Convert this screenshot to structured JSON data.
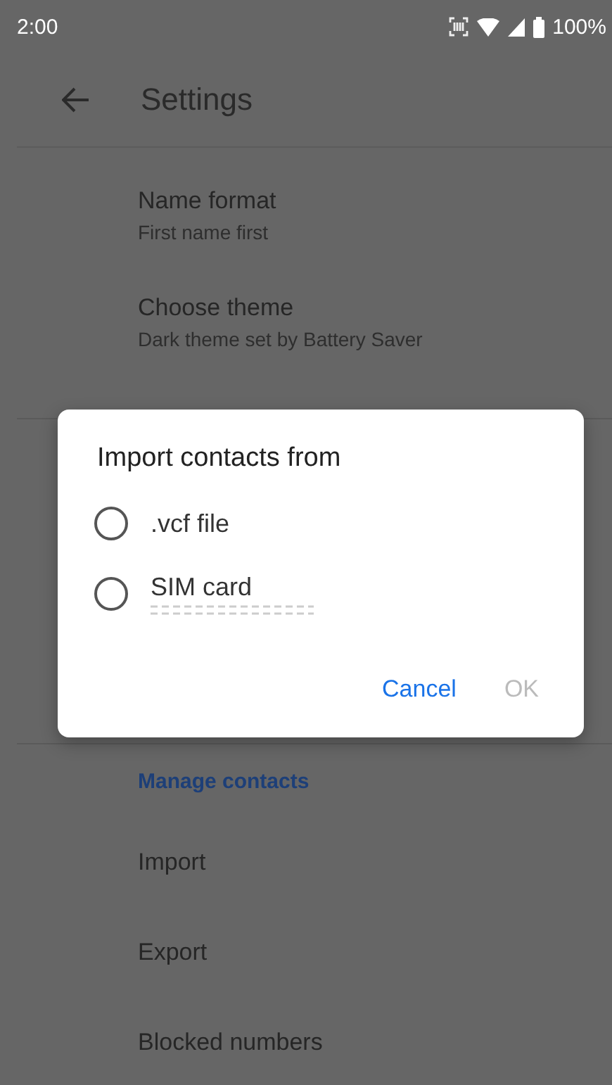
{
  "status_bar": {
    "time": "2:00",
    "battery": "100%"
  },
  "app_bar": {
    "title": "Settings"
  },
  "settings": [
    {
      "kind": "item",
      "title": "Name format",
      "subtitle": "First name first"
    },
    {
      "kind": "item",
      "title": "Choose theme",
      "subtitle": "Dark theme set by Battery Saver"
    }
  ],
  "manage": [
    {
      "kind": "header",
      "title": "Manage contacts"
    },
    {
      "kind": "item",
      "title": "Import"
    },
    {
      "kind": "item",
      "title": "Export"
    },
    {
      "kind": "item",
      "title": "Blocked numbers"
    }
  ],
  "dialog": {
    "title": "Import contacts from",
    "options": [
      {
        "label": ".vcf file",
        "selected": false,
        "redacted_detail": false
      },
      {
        "label": "SIM card",
        "selected": false,
        "redacted_detail": true
      }
    ],
    "buttons": [
      {
        "label": "Cancel",
        "disabled": false
      },
      {
        "label": "OK",
        "disabled": true
      }
    ]
  }
}
